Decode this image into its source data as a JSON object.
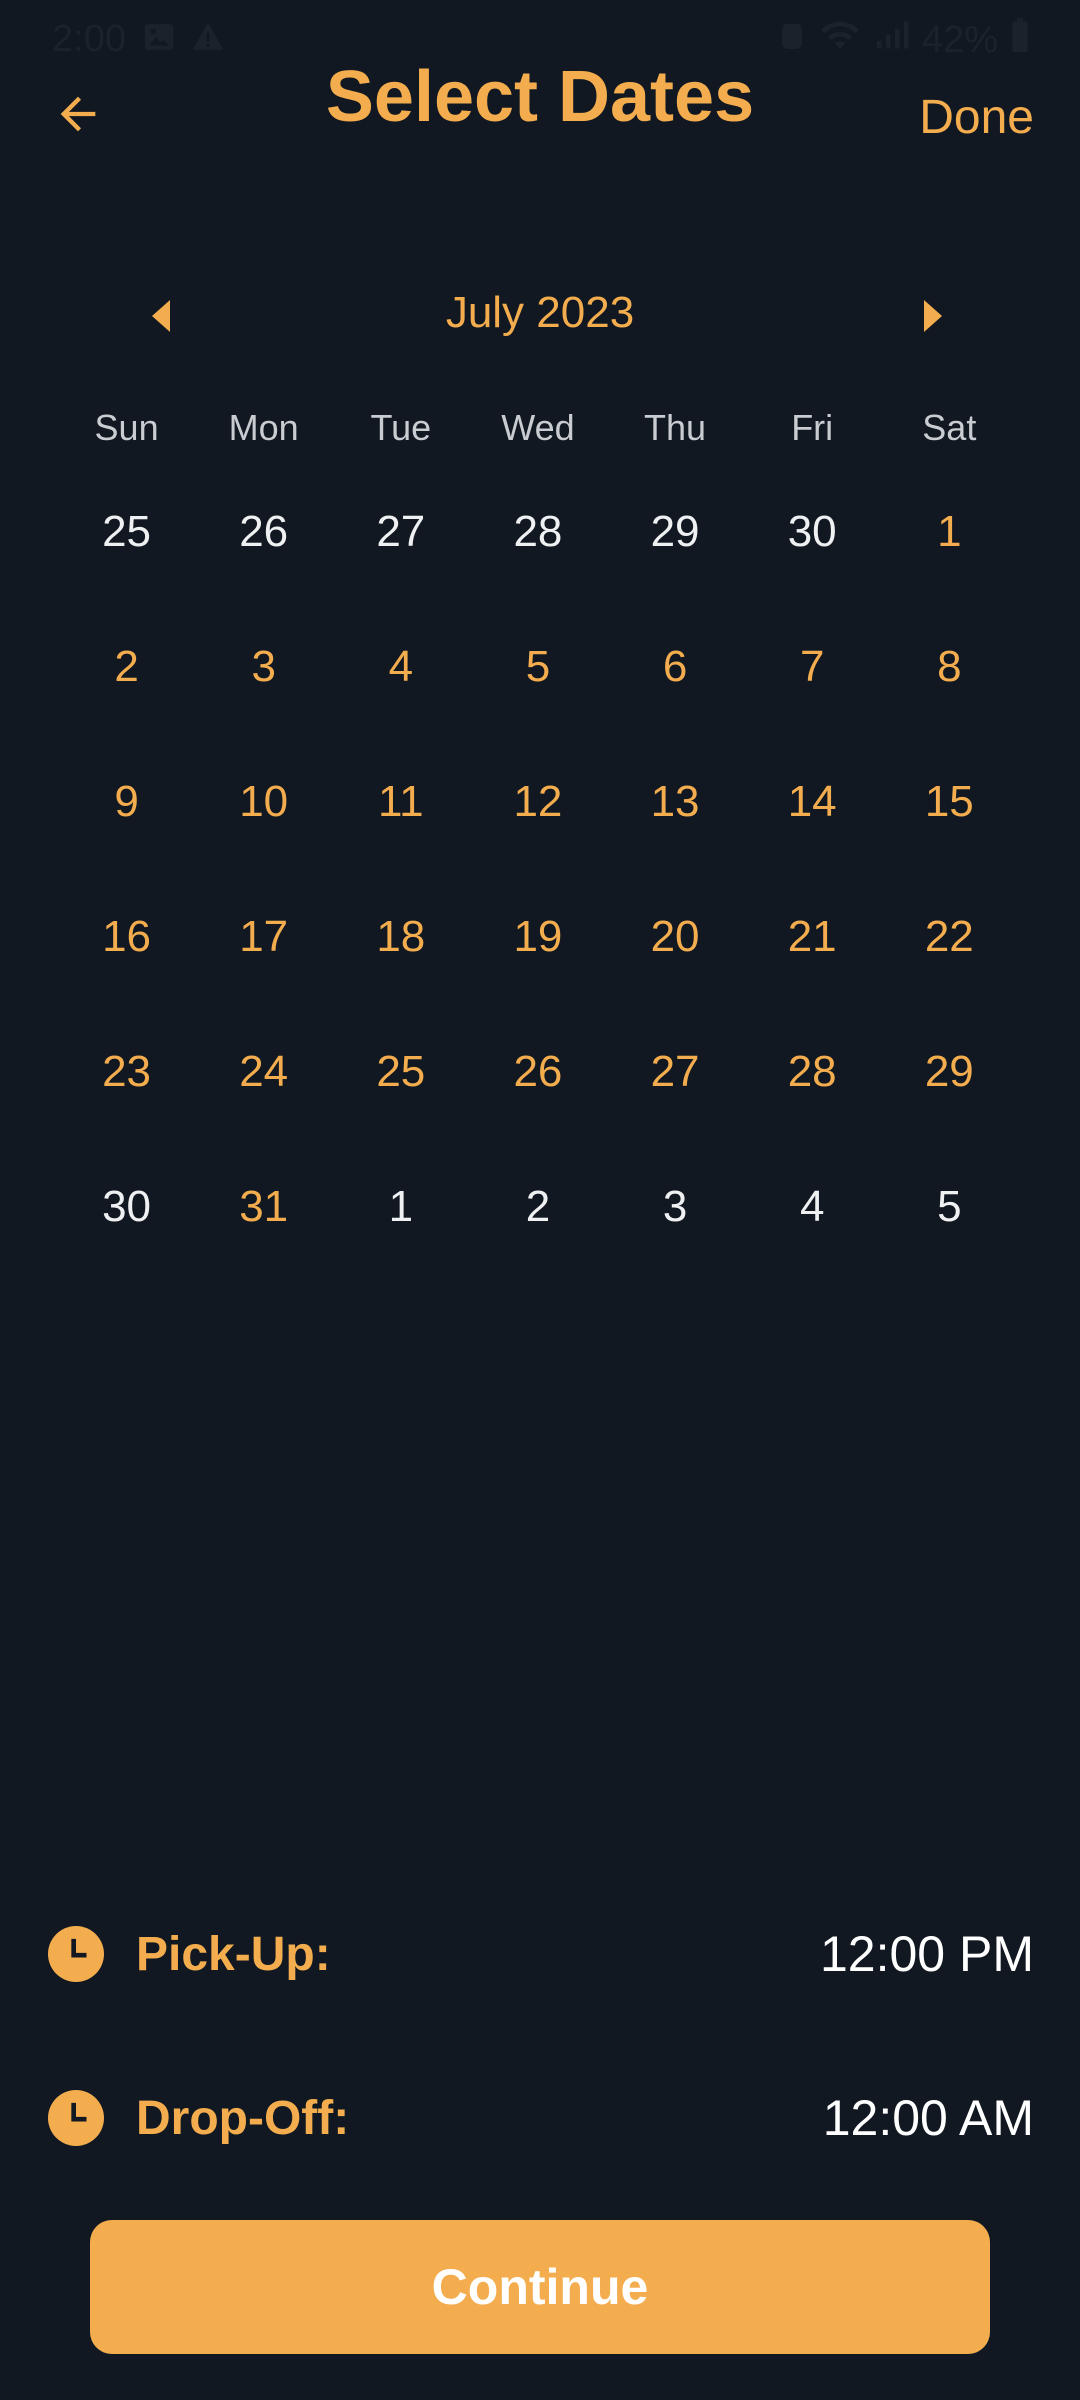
{
  "status_bar": {
    "time": "2:00",
    "battery": "42%"
  },
  "header": {
    "title": "Select Dates",
    "done_label": "Done"
  },
  "calendar": {
    "month_label": "July 2023",
    "weekdays": [
      "Sun",
      "Mon",
      "Tue",
      "Wed",
      "Thu",
      "Fri",
      "Sat"
    ],
    "weeks": [
      [
        {
          "d": "25",
          "in": false
        },
        {
          "d": "26",
          "in": false
        },
        {
          "d": "27",
          "in": false
        },
        {
          "d": "28",
          "in": false
        },
        {
          "d": "29",
          "in": false
        },
        {
          "d": "30",
          "in": false
        },
        {
          "d": "1",
          "in": true
        }
      ],
      [
        {
          "d": "2",
          "in": true
        },
        {
          "d": "3",
          "in": true
        },
        {
          "d": "4",
          "in": true
        },
        {
          "d": "5",
          "in": true
        },
        {
          "d": "6",
          "in": true
        },
        {
          "d": "7",
          "in": true
        },
        {
          "d": "8",
          "in": true
        }
      ],
      [
        {
          "d": "9",
          "in": true
        },
        {
          "d": "10",
          "in": true
        },
        {
          "d": "11",
          "in": true
        },
        {
          "d": "12",
          "in": true
        },
        {
          "d": "13",
          "in": true
        },
        {
          "d": "14",
          "in": true
        },
        {
          "d": "15",
          "in": true
        }
      ],
      [
        {
          "d": "16",
          "in": true
        },
        {
          "d": "17",
          "in": true
        },
        {
          "d": "18",
          "in": true
        },
        {
          "d": "19",
          "in": true
        },
        {
          "d": "20",
          "in": true
        },
        {
          "d": "21",
          "in": true
        },
        {
          "d": "22",
          "in": true
        }
      ],
      [
        {
          "d": "23",
          "in": true
        },
        {
          "d": "24",
          "in": true
        },
        {
          "d": "25",
          "in": true
        },
        {
          "d": "26",
          "in": true
        },
        {
          "d": "27",
          "in": true
        },
        {
          "d": "28",
          "in": true
        },
        {
          "d": "29",
          "in": true
        }
      ],
      [
        {
          "d": "30",
          "in": false
        },
        {
          "d": "31",
          "in": true
        },
        {
          "d": "1",
          "in": false
        },
        {
          "d": "2",
          "in": false
        },
        {
          "d": "3",
          "in": false
        },
        {
          "d": "4",
          "in": false
        },
        {
          "d": "5",
          "in": false
        }
      ]
    ]
  },
  "pickup": {
    "label": "Pick-Up:",
    "time": "12:00 PM"
  },
  "dropoff": {
    "label": "Drop-Off:",
    "time": "12:00 AM"
  },
  "continue_label": "Continue",
  "colors": {
    "accent": "#f4ad4e",
    "background": "#111821",
    "muted_day": "#eef0f2"
  }
}
